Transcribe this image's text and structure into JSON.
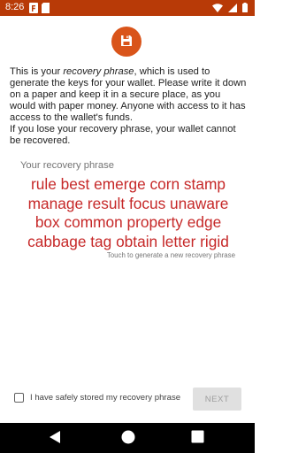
{
  "status_bar": {
    "time": "8:26",
    "left_icons": [
      "notification-f-icon",
      "sd-card-icon"
    ],
    "right_icons": [
      "wifi-icon",
      "signal-icon",
      "battery-icon"
    ],
    "color": "#b83a07"
  },
  "logo": {
    "icon": "floppy-disk-icon",
    "color": "#d9541a"
  },
  "intro": {
    "part1": "This is your ",
    "emphasis": "recovery phrase",
    "part2": ", which is used to generate the keys for your wallet. Please write it down on a paper and keep it in a secure place, as you would with paper money. Anyone with access to it has access to the wallet's funds.",
    "warning": "If you lose your recovery phrase, your wallet cannot be recovered."
  },
  "phrase": {
    "label": "Your recovery phrase",
    "lines": [
      "rule best emerge corn stamp",
      "manage result focus unaware",
      "box common property edge",
      "cabbage tag obtain letter rigid"
    ],
    "color": "#c62828",
    "hint": "Touch to generate a new recovery phrase"
  },
  "confirm": {
    "checkbox_label": "I have safely stored my recovery phrase",
    "checked": false,
    "next_label": "NEXT"
  },
  "nav_bar": {
    "icons": [
      "back-icon",
      "home-icon",
      "recents-icon"
    ]
  }
}
